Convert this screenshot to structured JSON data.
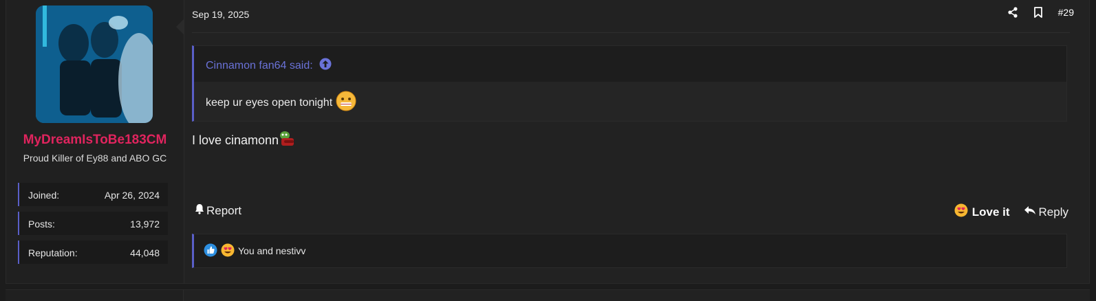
{
  "user": {
    "username": "MyDreamIsToBe183CM",
    "title": "Proud Killer of Ey88 and ABO GC",
    "stats": [
      {
        "label": "Joined:",
        "value": "Apr 26, 2024"
      },
      {
        "label": "Posts:",
        "value": "13,972"
      },
      {
        "label": "Reputation:",
        "value": "44,048"
      }
    ],
    "username_color": "#e0245e"
  },
  "post": {
    "date": "Sep 19, 2025",
    "number": "#29",
    "quote": {
      "author_line": "Cinnamon fan64 said:",
      "text": "keep ur eyes open tonight"
    },
    "message": "I love cinamonn",
    "actions": {
      "report": "Report",
      "love": "Love it",
      "reply": "Reply"
    },
    "reactions_text": "You and nestivv"
  },
  "icons": {
    "share": "share-icon",
    "bookmark": "bookmark-icon",
    "quote_jump": "arrow-up-circle-icon",
    "bell": "bell-icon",
    "reply": "reply-arrow-icon",
    "like": "thumbs-up-icon",
    "love": "heart-eyes-emoji"
  },
  "accent_color": "#5a5fc8"
}
